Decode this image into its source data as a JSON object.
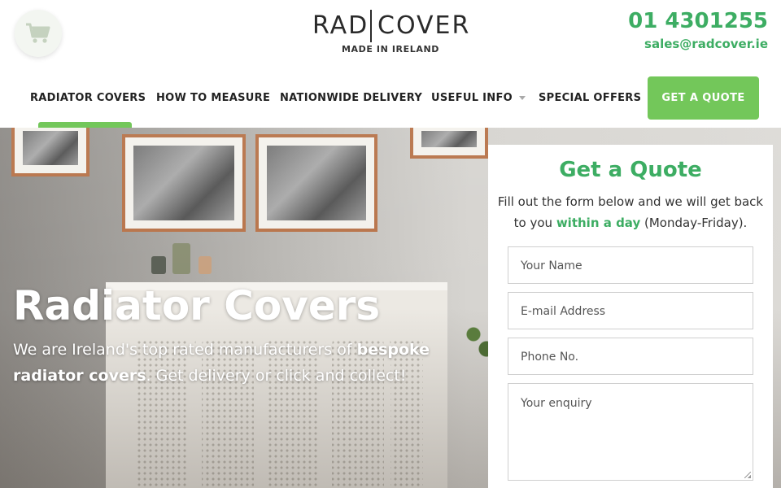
{
  "header": {
    "cart_icon": "shopping-cart-icon",
    "logo": {
      "left": "RAD",
      "right": "COVER",
      "tagline": "MADE IN IRELAND"
    },
    "phone": "01 4301255",
    "email": "sales@radcover.ie"
  },
  "nav": {
    "items": [
      {
        "label": "RADIATOR COVERS"
      },
      {
        "label": "HOW TO MEASURE"
      },
      {
        "label": "NATIONWIDE DELIVERY"
      },
      {
        "label": "USEFUL INFO"
      },
      {
        "label": "SPECIAL OFFERS"
      }
    ],
    "quote_button": "GET A QUOTE"
  },
  "hero": {
    "title": "Radiator Covers",
    "text_1": "We are Ireland's top rated manufacturers of ",
    "text_bold": "bespoke radiator covers",
    "text_2": ". Get delivery or click and collect!"
  },
  "form": {
    "title": "Get a Quote",
    "sub_1": "Fill out the form below and we will get back to you ",
    "sub_highlight": "within a day",
    "sub_2": " (Monday-Friday).",
    "name_placeholder": "Your Name",
    "email_placeholder": "E-mail Address",
    "phone_placeholder": "Phone No.",
    "enquiry_placeholder": "Your enquiry"
  },
  "colors": {
    "brand_green": "#3dad63",
    "button_green": "#73c75a",
    "text_dark": "#222222"
  }
}
